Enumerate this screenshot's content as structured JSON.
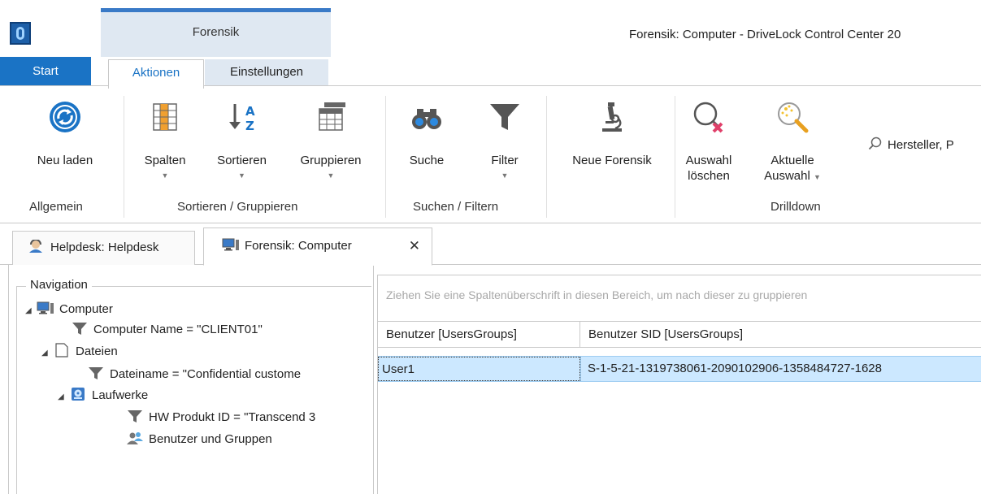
{
  "titlebar": {
    "context_group": "Forensik",
    "window_title": "Forensik: Computer - DriveLock Control Center 20"
  },
  "tabs": {
    "start": "Start",
    "aktionen": "Aktionen",
    "einstellungen": "Einstellungen"
  },
  "ribbon": {
    "buttons": {
      "neu_laden": "Neu laden",
      "spalten": "Spalten",
      "sortieren": "Sortieren",
      "gruppieren": "Gruppieren",
      "suche": "Suche",
      "filter": "Filter",
      "neue_forensik": "Neue Forensik",
      "auswahl_loeschen_1": "Auswahl",
      "auswahl_loeschen_2": "löschen",
      "aktuelle_auswahl_1": "Aktuelle",
      "aktuelle_auswahl_2": "Auswahl"
    },
    "groups": {
      "allgemein": "Allgemein",
      "sortieren_gruppieren": "Sortieren / Gruppieren",
      "suchen_filtern": "Suchen / Filtern",
      "drilldown": "Drilldown"
    },
    "search_text": "Hersteller, P",
    "accent_color": "#1a73c5"
  },
  "doc_tabs": {
    "helpdesk": "Helpdesk: Helpdesk",
    "forensik": "Forensik: Computer",
    "close_glyph": "✕"
  },
  "navigation": {
    "legend": "Navigation",
    "tree": {
      "computer": "Computer",
      "computer_filter": "Computer Name = \"CLIENT01\"",
      "dateien": "Dateien",
      "dateiname_filter": "Dateiname = \"Confidential custome",
      "laufwerke": "Laufwerke",
      "hw_filter": "HW Produkt ID = \"Transcend 3",
      "benutzer_gruppen": "Benutzer und Gruppen"
    }
  },
  "grid": {
    "group_panel_hint": "Ziehen Sie eine Spaltenüberschrift in diesen Bereich, um nach dieser zu gruppieren",
    "columns": [
      "Benutzer [UsersGroups]",
      "Benutzer SID [UsersGroups]"
    ],
    "rows": [
      [
        "User1",
        "S-1-5-21-1319738061-2090102906-1358484727-1628"
      ]
    ],
    "selected_row_color": "#cce8ff"
  }
}
